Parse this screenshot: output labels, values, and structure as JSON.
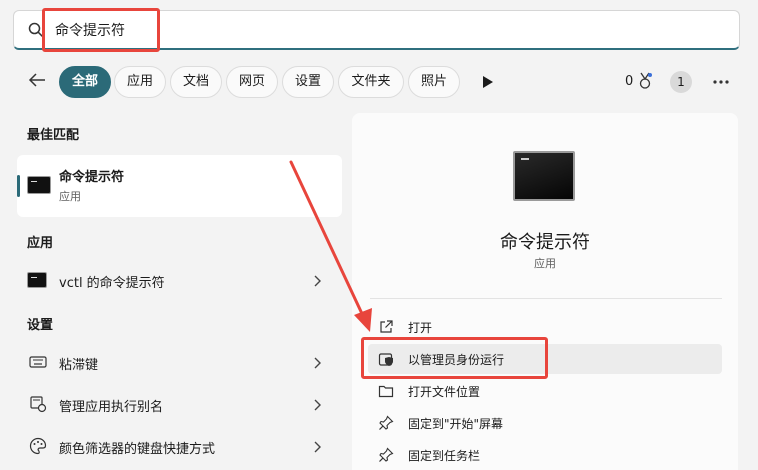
{
  "search": {
    "query": "命令提示符",
    "icon": "search-icon"
  },
  "filters": {
    "tabs": [
      {
        "label": "全部",
        "active": true
      },
      {
        "label": "应用",
        "active": false
      },
      {
        "label": "文档",
        "active": false
      },
      {
        "label": "网页",
        "active": false
      },
      {
        "label": "设置",
        "active": false
      },
      {
        "label": "文件夹",
        "active": false
      },
      {
        "label": "照片",
        "active": false
      }
    ],
    "reward_count": "0",
    "avatar_badge": "1"
  },
  "sections": {
    "best_match": "最佳匹配",
    "apps": "应用",
    "settings": "设置"
  },
  "best_match": {
    "title": "命令提示符",
    "subtitle": "应用"
  },
  "apps": [
    {
      "label": "vctl 的命令提示符"
    }
  ],
  "settings": [
    {
      "label": "粘滞键",
      "icon": "keyboard-icon"
    },
    {
      "label": "管理应用执行别名",
      "icon": "app-alias-icon"
    },
    {
      "label": "颜色筛选器的键盘快捷方式",
      "icon": "palette-icon"
    }
  ],
  "detail": {
    "title": "命令提示符",
    "subtitle": "应用",
    "actions": [
      {
        "label": "打开",
        "icon": "open-external-icon"
      },
      {
        "label": "以管理员身份运行",
        "icon": "shield-icon"
      },
      {
        "label": "打开文件位置",
        "icon": "folder-icon"
      },
      {
        "label": "固定到\"开始\"屏幕",
        "icon": "pin-icon"
      },
      {
        "label": "固定到任务栏",
        "icon": "pin-icon"
      }
    ]
  },
  "colors": {
    "accent": "#2b6a78",
    "annotation": "#e8453c"
  }
}
